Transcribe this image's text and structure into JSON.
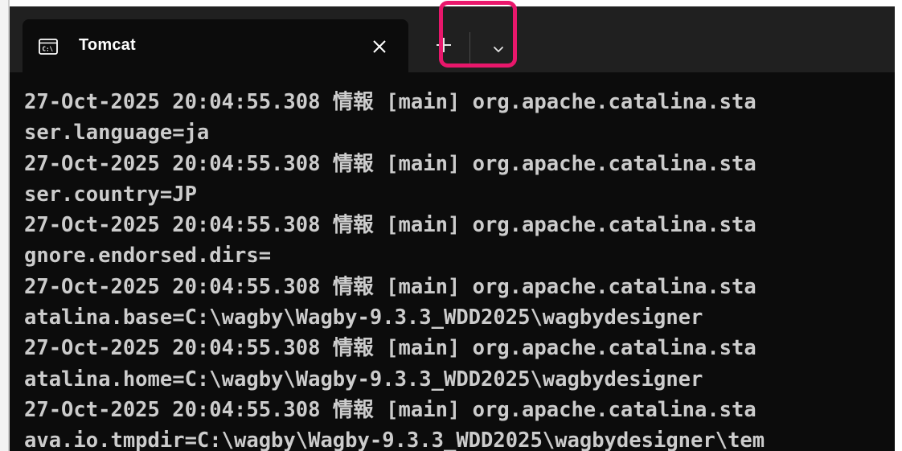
{
  "tab": {
    "title": "Tomcat",
    "icon": "terminal-cmd-icon",
    "close_icon": "close-icon"
  },
  "toolbar": {
    "new_tab_icon": "plus-icon",
    "dropdown_icon": "chevron-down-icon",
    "highlight_color": "#e8176b"
  },
  "terminal": {
    "lines": [
      "27-Oct-2025 20:04:55.308 情報 [main] org.apache.catalina.sta",
      "ser.language=ja",
      "27-Oct-2025 20:04:55.308 情報 [main] org.apache.catalina.sta",
      "ser.country=JP",
      "27-Oct-2025 20:04:55.308 情報 [main] org.apache.catalina.sta",
      "gnore.endorsed.dirs=",
      "27-Oct-2025 20:04:55.308 情報 [main] org.apache.catalina.sta",
      "atalina.base=C:\\wagby\\Wagby-9.3.3_WDD2025\\wagbydesigner",
      "27-Oct-2025 20:04:55.308 情報 [main] org.apache.catalina.sta",
      "atalina.home=C:\\wagby\\Wagby-9.3.3_WDD2025\\wagbydesigner",
      "27-Oct-2025 20:04:55.308 情報 [main] org.apache.catalina.sta",
      "ava.io.tmpdir=C:\\wagby\\Wagby-9.3.3_WDD2025\\wagbydesigner\\tem"
    ],
    "text_color": "#cccccc",
    "background": "#0c0c0c"
  }
}
